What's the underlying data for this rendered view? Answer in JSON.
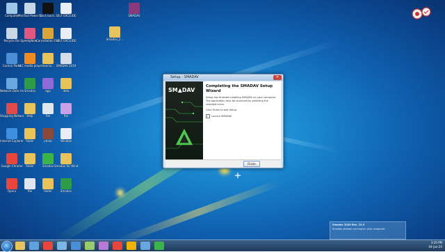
{
  "dialog": {
    "window_title": "Setup - SMADAV",
    "close_glyph": "✕",
    "brand": "SM▲DAV",
    "heading": "Completing the SMADAV Setup Wizard",
    "desc": "Setup has finished installing SMADAV on your computer. The application may be launched by selecting the installed icons.",
    "click_finish": "Click Finish to exit Setup.",
    "launch_label": "Launch SMADAV",
    "launch_checked": true,
    "finish_label": "Finish"
  },
  "desktop_icons": [
    {
      "label": "Computer",
      "icon": "computer-icon",
      "color": "#9fc7e8"
    },
    {
      "label": "MiniTool Power Dat...",
      "icon": "minitool-icon",
      "color": "#c8d8e8"
    },
    {
      "label": "black back...",
      "icon": "image-file-icon",
      "color": "#111111"
    },
    {
      "label": "SELF EXCLUDE",
      "icon": "document-icon",
      "color": "#e9eef5"
    },
    {
      "label": "Recycle Bin",
      "icon": "recycle-bin-icon",
      "color": "#c9d6e3"
    },
    {
      "label": "SpeedyNew...",
      "icon": "app-icon",
      "color": "#e0577f"
    },
    {
      "label": "Cancellation Forms",
      "icon": "zip-icon",
      "color": "#d9a43a"
    },
    {
      "label": "SELF EXCLUDE",
      "icon": "document-icon",
      "color": "#e9eef5"
    },
    {
      "label": "Control Panel",
      "icon": "control-panel-icon",
      "color": "#4a8fd6"
    },
    {
      "label": "VLC media player",
      "icon": "vlc-icon",
      "color": "#f08a24"
    },
    {
      "label": "How to...",
      "icon": "folder-icon",
      "color": "#e8c25a"
    },
    {
      "label": "SMADAV 2019",
      "icon": "document-icon",
      "color": "#d5dde8"
    },
    {
      "label": "Network Data Unit",
      "icon": "network-icon",
      "color": "#6aa6e0"
    },
    {
      "label": "Smadav",
      "icon": "smadav-icon",
      "color": "#2e9b46"
    },
    {
      "label": "app",
      "icon": "app-icon",
      "color": "#8d6bd6"
    },
    {
      "label": "data",
      "icon": "folder-icon",
      "color": "#e8c25a"
    },
    {
      "label": "Shopping Network",
      "icon": "app-icon",
      "color": "#e24b4b"
    },
    {
      "label": "Help",
      "icon": "folder-icon",
      "color": "#e8c25a"
    },
    {
      "label": "file",
      "icon": "document-icon",
      "color": "#dfe6ee"
    },
    {
      "label": "file",
      "icon": "document-icon",
      "color": "#c9a0e8"
    },
    {
      "label": "Internet Explorer",
      "icon": "ie-icon",
      "color": "#3d8fe0"
    },
    {
      "label": "folder",
      "icon": "folder-icon",
      "color": "#e8c25a"
    },
    {
      "label": "photo",
      "icon": "photo-icon",
      "color": "#8a4a3a"
    },
    {
      "label": "Window",
      "icon": "document-icon",
      "color": "#e9eef5"
    },
    {
      "label": "Google Chrome",
      "icon": "chrome-icon",
      "color": "#e8453c"
    },
    {
      "label": "folder",
      "icon": "folder-icon",
      "color": "#e8c25a"
    },
    {
      "label": "Smadav",
      "icon": "smadav-icon",
      "color": "#3bb54a"
    },
    {
      "label": "Smadav for Windows 10",
      "icon": "smadav-icon",
      "color": "#e8c25a"
    },
    {
      "label": "Opera",
      "icon": "opera-icon",
      "color": "#e8453c"
    },
    {
      "label": "file",
      "icon": "document-icon",
      "color": "#dfe6ee"
    },
    {
      "label": "folder",
      "icon": "folder-icon",
      "color": "#e8c25a"
    },
    {
      "label": "Smadav",
      "icon": "smadav-icon",
      "color": "#2e9b46"
    }
  ],
  "taskbar": {
    "start": "start-orb-icon",
    "clock_time": "3:20 PM",
    "clock_date": "04-Jun-20",
    "pinned": [
      {
        "icon": "explorer-icon",
        "color": "#e8c25a"
      },
      {
        "icon": "media-icon",
        "color": "#5ea0e0"
      },
      {
        "icon": "chrome-icon",
        "color": "#e8453c"
      },
      {
        "icon": "app-icon",
        "color": "#7ab6e8"
      },
      {
        "icon": "app-icon",
        "color": "#4a8fd6"
      },
      {
        "icon": "app-icon",
        "color": "#9acb6a"
      },
      {
        "icon": "app-icon",
        "color": "#b97ad6"
      },
      {
        "icon": "opera-icon",
        "color": "#e8453c"
      },
      {
        "icon": "chrome-icon",
        "color": "#f0b400"
      },
      {
        "icon": "app-icon",
        "color": "#6aa6e0"
      },
      {
        "icon": "smadav-icon",
        "color": "#3bb54a"
      }
    ]
  },
  "notification": {
    "title": "Smadav 2020 Rev. 13.5",
    "text": "Smadav already running on your computer."
  }
}
